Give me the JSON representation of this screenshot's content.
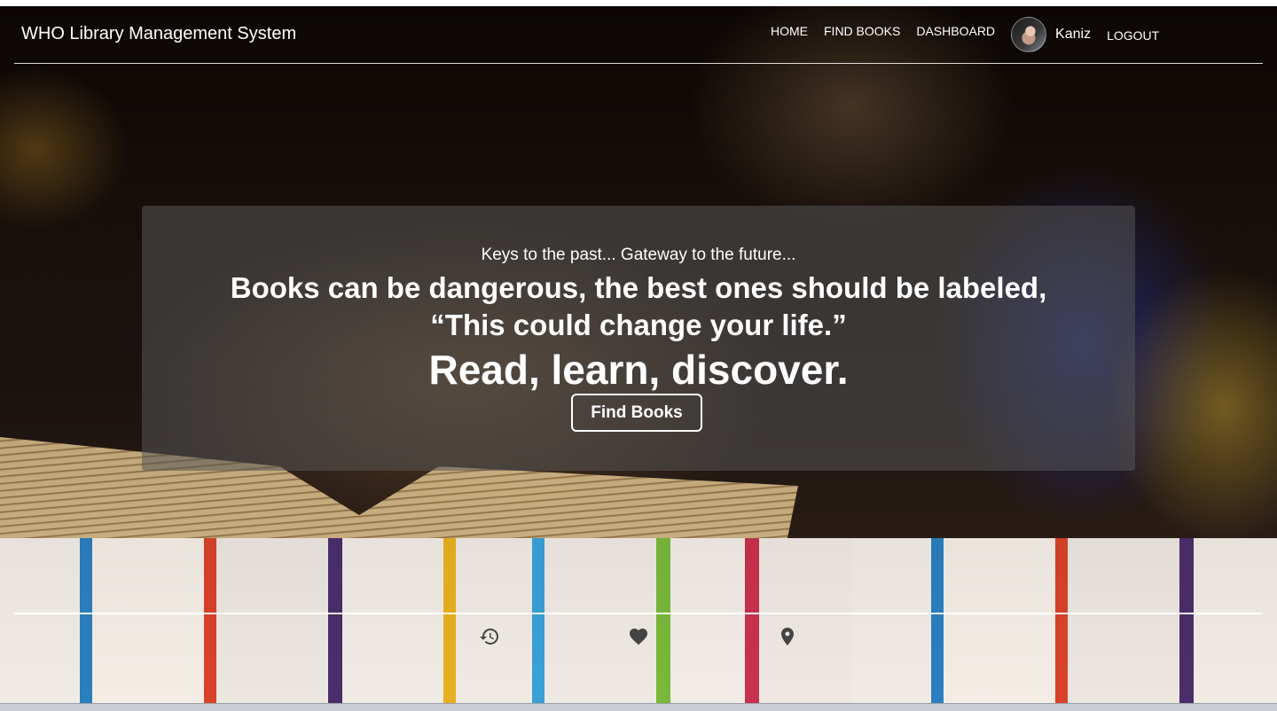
{
  "header": {
    "brand": "WHO Library Management System",
    "nav": [
      {
        "label": "HOME"
      },
      {
        "label": "FIND BOOKS"
      },
      {
        "label": "DASHBOARD"
      }
    ],
    "user": {
      "name": "Kaniz"
    },
    "logout_label": "LOGOUT"
  },
  "hero": {
    "tagline": "Keys to the past... Gateway to the future...",
    "quote_line1": "Books can be dangerous, the best ones should be labeled,",
    "quote_line2": "“This could change your life.”",
    "slogan": "Read, learn, discover.",
    "cta_label": "Find Books"
  },
  "footer": {
    "icons": [
      "history-icon",
      "heart-icon",
      "map-marker-icon"
    ]
  },
  "colors": {
    "text": "#ffffff",
    "card_overlay": "rgba(85,85,85,0.55)"
  }
}
